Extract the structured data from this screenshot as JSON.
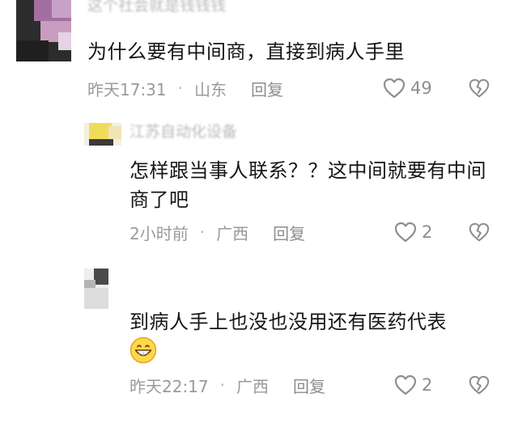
{
  "comments": [
    {
      "username": "这个社会就是钱钱钱",
      "text": "为什么要有中间商，直接到病人手里",
      "time": "昨天17:31",
      "separator": "·",
      "location": "山东",
      "reply_label": "回复",
      "likes": "49"
    },
    {
      "username": "江苏自动化设备",
      "text": "怎样跟当事人联系？？这中间就要有中间商了吧",
      "time": "2小时前",
      "separator": "·",
      "location": "广西",
      "reply_label": "回复",
      "likes": "2"
    },
    {
      "username": "",
      "text": "到病人手上也没也没用还有医药代表",
      "time": "昨天22:17",
      "separator": "·",
      "location": "广西",
      "reply_label": "回复",
      "likes": "2"
    }
  ],
  "icons": {
    "like": "heart-outline-icon",
    "dislike": "broken-heart-icon",
    "emoji": "grinning-face-emoji"
  },
  "colors": {
    "text": "#161616",
    "meta": "#9a9a9a",
    "icon": "#8e8e8e",
    "emoji_face": "#ffd84a"
  }
}
